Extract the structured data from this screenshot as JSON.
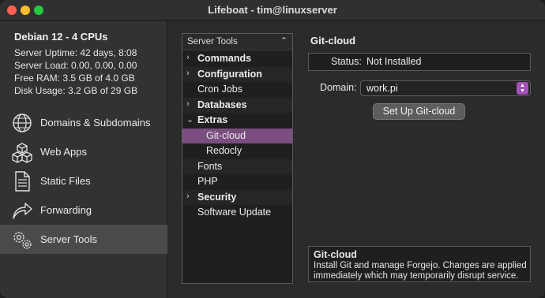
{
  "window": {
    "title": "Lifeboat - tim@linuxserver"
  },
  "system": {
    "title": "Debian 12 - 4 CPUs",
    "lines": [
      "Server Uptime: 42 days, 8:08",
      "Server Load: 0.00, 0.00, 0.00",
      "Free RAM: 3.5 GB of 4.0 GB",
      "Disk Usage: 3.2 GB of 29 GB"
    ]
  },
  "nav": [
    {
      "label": "Domains & Subdomains",
      "icon": "globe-icon"
    },
    {
      "label": "Web Apps",
      "icon": "cubes-icon"
    },
    {
      "label": "Static Files",
      "icon": "document-icon"
    },
    {
      "label": "Forwarding",
      "icon": "forward-arrow-icon"
    },
    {
      "label": "Server Tools",
      "icon": "gears-icon",
      "selected": true
    }
  ],
  "tools": {
    "header": "Server Tools",
    "rows": [
      {
        "label": "Commands",
        "bold": true,
        "disclosure": "›"
      },
      {
        "label": "Configuration",
        "bold": true,
        "disclosure": "›"
      },
      {
        "label": "Cron Jobs",
        "bold": false
      },
      {
        "label": "Databases",
        "bold": true,
        "disclosure": "›"
      },
      {
        "label": "Extras",
        "bold": true,
        "disclosure": "⌄"
      },
      {
        "label": "Git-cloud",
        "bold": false,
        "selected": true,
        "indent": true
      },
      {
        "label": "Redocly",
        "bold": false,
        "indent": true
      },
      {
        "label": "Fonts",
        "bold": false
      },
      {
        "label": "PHP",
        "bold": false
      },
      {
        "label": "Security",
        "bold": true,
        "disclosure": "›"
      },
      {
        "label": "Software Update",
        "bold": false
      }
    ]
  },
  "panel": {
    "title": "Git-cloud",
    "status_label": "Status:",
    "status_value": "Not Installed",
    "domain_label": "Domain:",
    "domain_value": "work.pi",
    "setup_button": "Set Up Git-cloud",
    "desc_title": "Git-cloud",
    "desc_text": "Install Git and manage Forgejo. Changes are applied immediately which may temporarily disrupt service."
  },
  "colors": {
    "selection": "#7a4e80",
    "select_accent": "#a450b8"
  }
}
